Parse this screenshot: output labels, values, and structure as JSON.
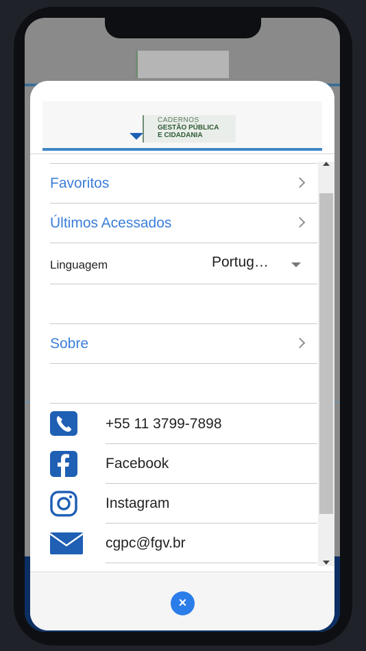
{
  "app": {
    "logo_lines": [
      "CADERNOS",
      "GESTÃO PÚBLICA",
      "E CIDADANIA"
    ]
  },
  "menu": {
    "favorites_label": "Favoritos",
    "recent_label": "Últimos Acessados",
    "language_label": "Linguagem",
    "language_value": "Portug…",
    "about_label": "Sobre"
  },
  "contacts": {
    "phone": "+55 11 3799-7898",
    "facebook": "Facebook",
    "instagram": "Instagram",
    "email": "cgpc@fgv.br"
  },
  "footer": {
    "close_glyph": "×"
  },
  "colors": {
    "accent": "#3b7ed9",
    "icon_blue": "#1f5fb4",
    "header_rule": "#3d86c6"
  },
  "icons": [
    "phone-icon",
    "facebook-icon",
    "instagram-icon",
    "mail-icon",
    "chevron-right-icon",
    "caret-down-icon",
    "close-icon"
  ]
}
